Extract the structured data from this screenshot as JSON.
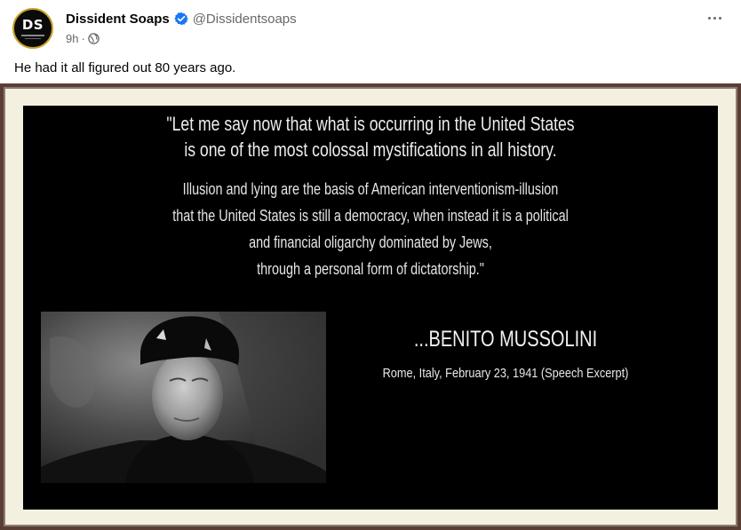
{
  "post": {
    "author_name": "Dissident Soaps",
    "author_handle": "@Dissidentsoaps",
    "avatar_monogram": "DS",
    "time": "9h",
    "separator": "·",
    "text": "He had it all figured out 80 years ago."
  },
  "image": {
    "quote_lines": [
      "\"Let me say now that what is occurring in the United States",
      "is one of the most colossal mystifications in all history."
    ],
    "body_lines": [
      "Illusion and lying are the basis of American interventionism-illusion",
      "that the United States is still a democracy, when instead it is a political",
      "and financial oligarchy dominated by Jews,",
      "through a personal form of dictatorship.\""
    ],
    "attribution": "...BENITO MUSSOLINI",
    "attribution_detail": "Rome, Italy, February 23, 1941 (Speech Excerpt)"
  },
  "icons": {
    "verified": "verified-badge-icon",
    "audience": "globe-icon",
    "more": "more-options-icon"
  },
  "colors": {
    "verified_blue": "#1877f2",
    "secondary_text": "#65676b",
    "frame_brown": "#5a3e34",
    "mat_cream": "#f4f0df"
  }
}
